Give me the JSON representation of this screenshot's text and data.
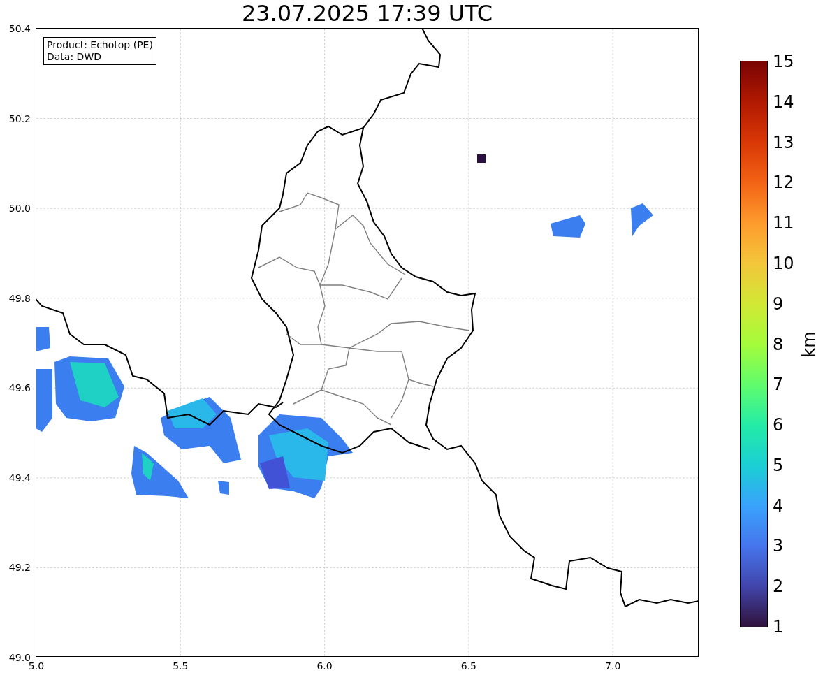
{
  "title": "23.07.2025 17:39 UTC",
  "legend": [
    "Product: Echotop (PE)",
    "Data: DWD"
  ],
  "x_axis": {
    "ticks": [
      "5.0",
      "5.5",
      "6.0",
      "6.5",
      "7.0"
    ]
  },
  "y_axis": {
    "ticks": [
      "50.4",
      "50.2",
      "50.0",
      "49.8",
      "49.6",
      "49.4",
      "49.2",
      "49.0"
    ]
  },
  "colorbar": {
    "label": "km",
    "ticks": [
      "15",
      "14",
      "13",
      "12",
      "11",
      "10",
      "9",
      "8",
      "7",
      "6",
      "5",
      "4",
      "3",
      "2",
      "1"
    ]
  }
}
